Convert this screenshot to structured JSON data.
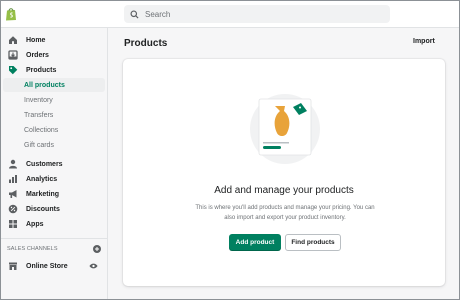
{
  "topbar": {
    "logo_icon": "shopify-bag-icon",
    "search_placeholder": "Search"
  },
  "sidebar": {
    "items": [
      {
        "label": "Home",
        "icon": "home-icon"
      },
      {
        "label": "Orders",
        "icon": "orders-icon"
      },
      {
        "label": "Products",
        "icon": "tag-icon"
      }
    ],
    "product_subitems": [
      {
        "label": "All products",
        "active": true
      },
      {
        "label": "Inventory"
      },
      {
        "label": "Transfers"
      },
      {
        "label": "Collections"
      },
      {
        "label": "Gift cards"
      }
    ],
    "items_after": [
      {
        "label": "Customers",
        "icon": "person-icon"
      },
      {
        "label": "Analytics",
        "icon": "bar-chart-icon"
      },
      {
        "label": "Marketing",
        "icon": "megaphone-icon"
      },
      {
        "label": "Discounts",
        "icon": "discount-icon"
      },
      {
        "label": "Apps",
        "icon": "apps-icon"
      }
    ],
    "sales_channels_label": "SALES CHANNELS",
    "online_store_label": "Online Store"
  },
  "main": {
    "title": "Products",
    "import_label": "Import",
    "empty_state": {
      "heading": "Add and manage your products",
      "description": "This is where you'll add products and manage your pricing. You can also import and export your product inventory.",
      "primary_label": "Add product",
      "secondary_label": "Find products"
    }
  },
  "colors": {
    "accent": "#008060",
    "active_text": "#008060",
    "vase": "#e8a33a"
  }
}
